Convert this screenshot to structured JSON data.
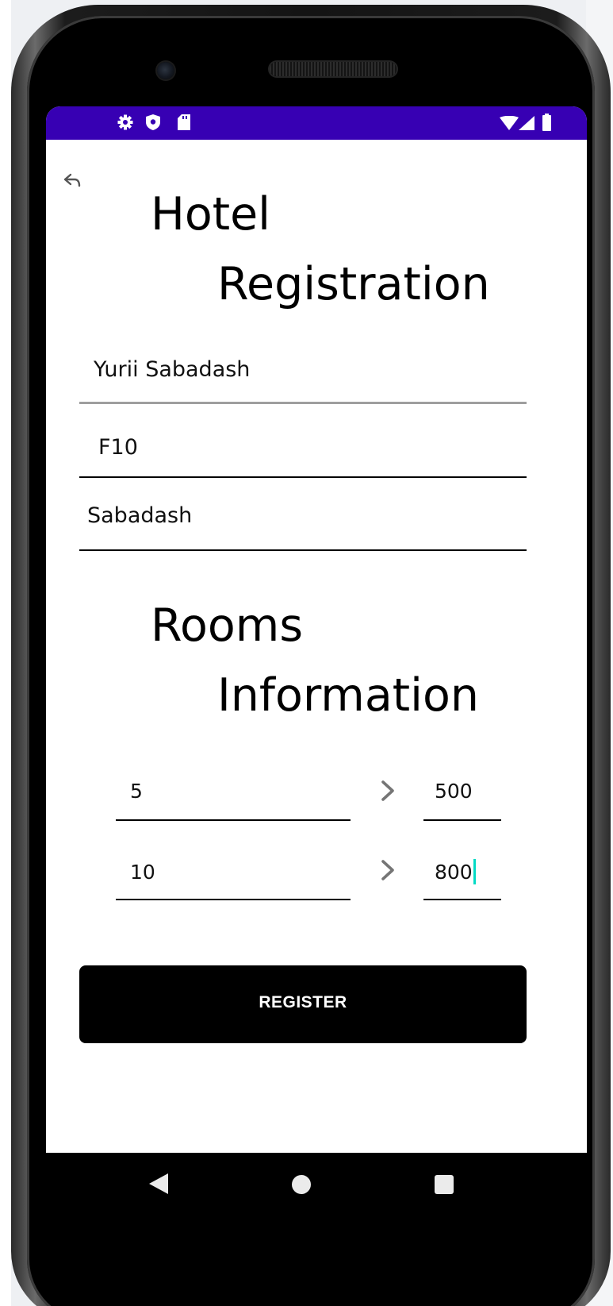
{
  "app": {
    "title_line1": "Hotel",
    "title_line2": "Registration",
    "section_line1": "Rooms",
    "section_line2": "Information"
  },
  "form": {
    "full_name_value": "Yurii Sabadash",
    "room_value": "F10",
    "surname_value": "Sabadash"
  },
  "rooms": [
    {
      "count_value": "5",
      "price_value": "500"
    },
    {
      "count_value": "10",
      "price_value": "800"
    }
  ],
  "actions": {
    "register_label": "REGISTER"
  },
  "status_bar": {
    "left_icons": [
      "gear-icon",
      "shield-icon",
      "sd-card-icon"
    ],
    "right_icons": [
      "wifi-icon",
      "signal-icon",
      "battery-icon"
    ],
    "color": "#3700b3"
  },
  "colors": {
    "accent_cursor": "#03dac5",
    "button_background": "#000000"
  }
}
